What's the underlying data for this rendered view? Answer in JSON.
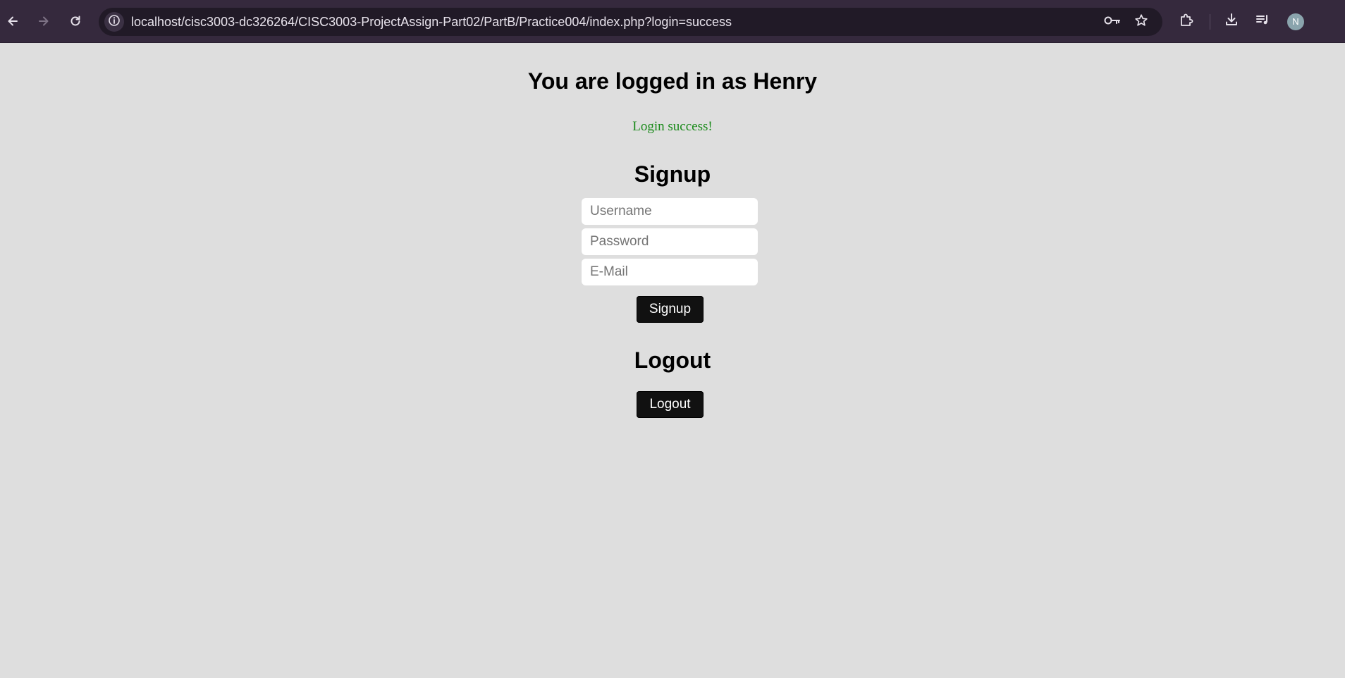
{
  "browser": {
    "url": "localhost/cisc3003-dc326264/CISC3003-ProjectAssign-Part02/PartB/Practice004/index.php?login=success",
    "icons": {
      "back": "arrow-left-icon",
      "forward": "arrow-right-icon",
      "reload": "reload-icon",
      "site_info": "info-icon",
      "password": "key-icon",
      "bookmark": "star-icon",
      "extensions": "puzzle-icon",
      "downloads": "download-icon",
      "media": "media-queue-icon"
    },
    "profile_initial": "N",
    "colors": {
      "toolbar": "#35293d",
      "omnibox": "#211a27",
      "avatar": "#8aa4ad"
    }
  },
  "page": {
    "logged_in_heading": "You are logged in as Henry",
    "status_message": "Login success!",
    "signup": {
      "heading": "Signup",
      "username_placeholder": "Username",
      "password_placeholder": "Password",
      "email_placeholder": "E-Mail",
      "button_label": "Signup"
    },
    "logout": {
      "heading": "Logout",
      "button_label": "Logout"
    },
    "colors": {
      "background": "#dedede",
      "success_text": "#1a8a1a",
      "button_bg": "#111111"
    }
  }
}
